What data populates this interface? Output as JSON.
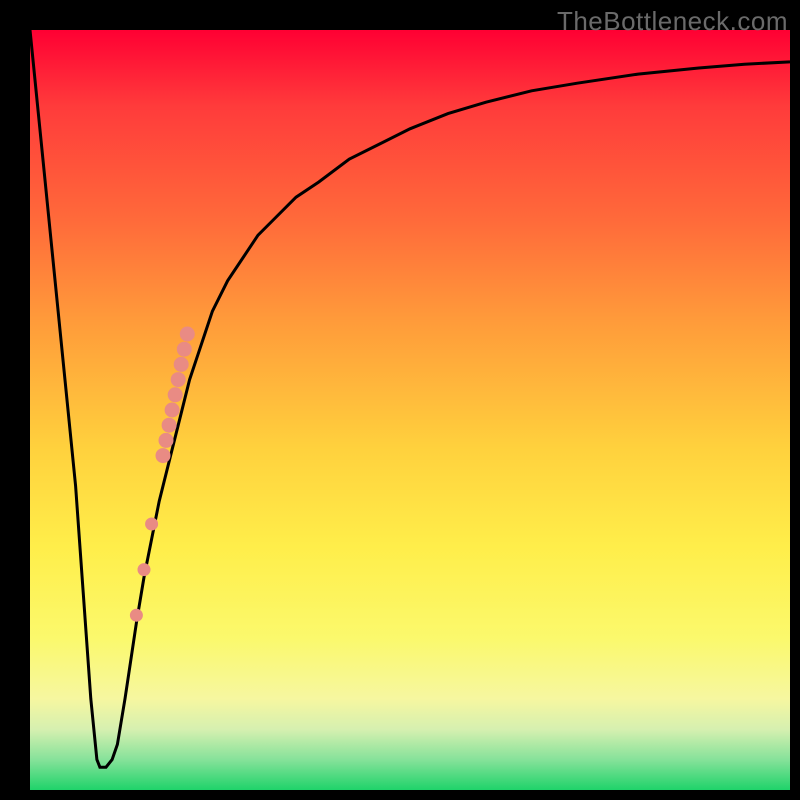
{
  "watermark": "TheBottleneck.com",
  "chart_data": {
    "type": "line",
    "title": "",
    "xlabel": "",
    "ylabel": "",
    "xlim": [
      0,
      100
    ],
    "ylim": [
      0,
      100
    ],
    "grid": false,
    "series": [
      {
        "name": "curve",
        "x": [
          0,
          2,
          4,
          6,
          7,
          8,
          8.8,
          9.2,
          10,
          10.8,
          11.5,
          12.5,
          14,
          15,
          16,
          17,
          18,
          19,
          20,
          21,
          22,
          23,
          24,
          26,
          28,
          30,
          32,
          35,
          38,
          42,
          46,
          50,
          55,
          60,
          66,
          72,
          80,
          88,
          94,
          100
        ],
        "y": [
          100,
          80,
          60,
          40,
          26,
          12,
          4,
          3,
          3,
          4,
          6,
          12,
          22,
          28,
          33,
          38,
          42,
          46,
          50,
          54,
          57,
          60,
          63,
          67,
          70,
          73,
          75,
          78,
          80,
          83,
          85,
          87,
          89,
          90.5,
          92,
          93,
          94.2,
          95,
          95.5,
          95.8
        ]
      }
    ],
    "markers": [
      {
        "x": 17.5,
        "y": 44,
        "r": 7
      },
      {
        "x": 17.9,
        "y": 46,
        "r": 7
      },
      {
        "x": 18.3,
        "y": 48,
        "r": 7
      },
      {
        "x": 18.7,
        "y": 50,
        "r": 7
      },
      {
        "x": 19.1,
        "y": 52,
        "r": 7
      },
      {
        "x": 19.5,
        "y": 54,
        "r": 7
      },
      {
        "x": 19.9,
        "y": 56,
        "r": 7
      },
      {
        "x": 20.3,
        "y": 58,
        "r": 7
      },
      {
        "x": 20.7,
        "y": 60,
        "r": 7
      },
      {
        "x": 16.0,
        "y": 35,
        "r": 6
      },
      {
        "x": 15.0,
        "y": 29,
        "r": 6
      },
      {
        "x": 14.0,
        "y": 23,
        "r": 6
      }
    ],
    "colors": {
      "curve": "#000000",
      "marker_fill": "#e98b84",
      "marker_stroke": "#e98b84"
    }
  }
}
